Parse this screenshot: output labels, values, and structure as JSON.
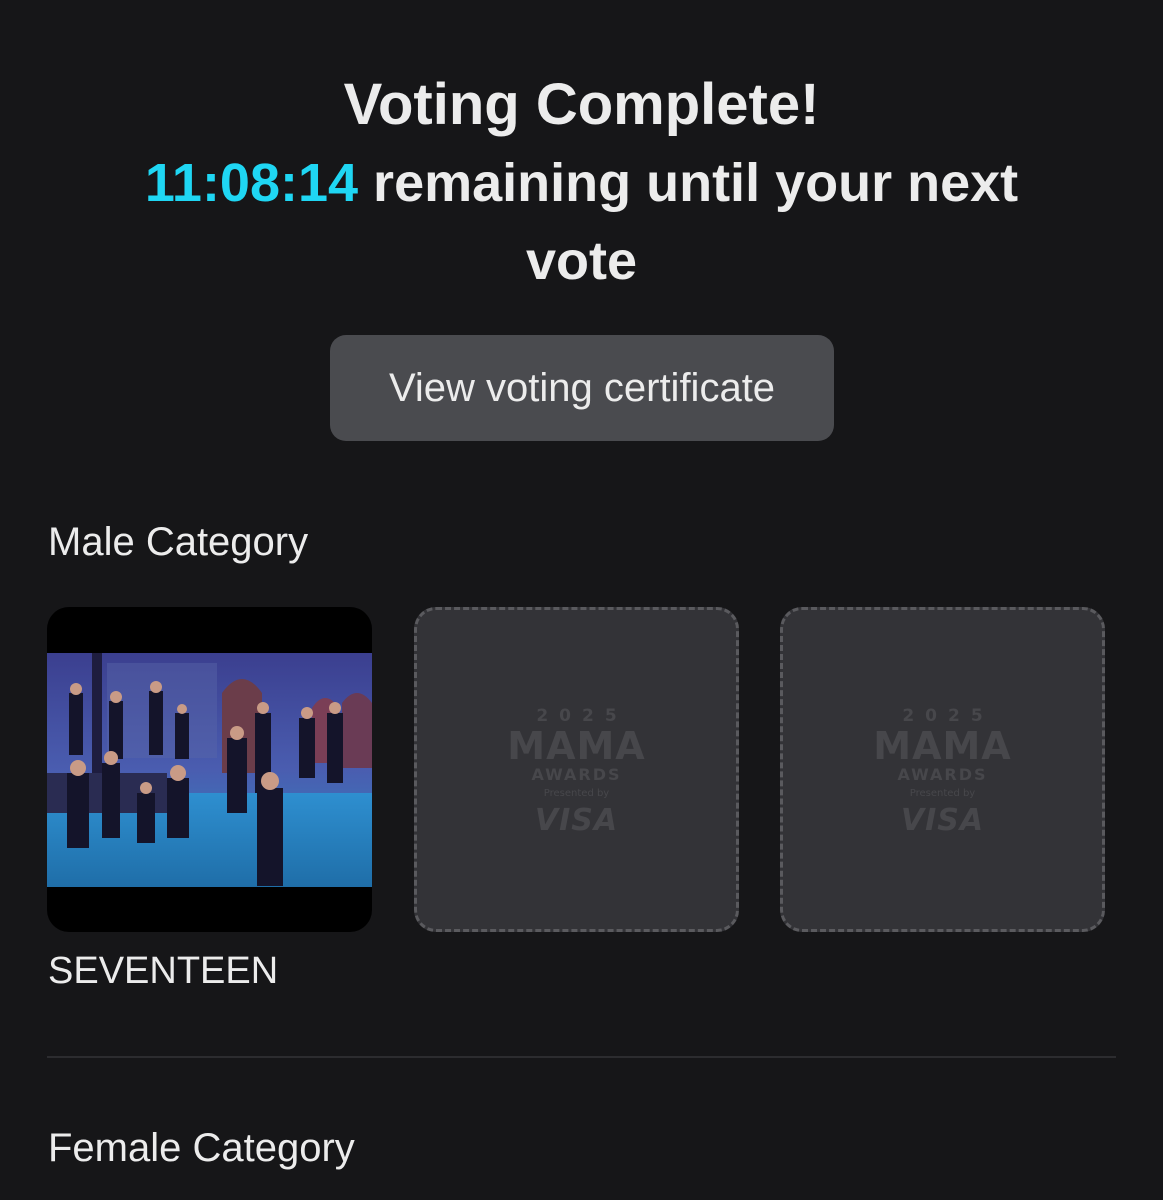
{
  "header": {
    "title": "Voting Complete!",
    "timer": "11:08:14",
    "countdown_text": " remaining until your next vote"
  },
  "certificate_button": {
    "label": "View voting certificate"
  },
  "male_category": {
    "title": "Male Category",
    "slots": [
      {
        "state": "voted",
        "artist": "SEVENTEEN",
        "image": "group-photo"
      },
      {
        "state": "empty",
        "placeholder_logo": {
          "year": "2025",
          "name": "MAMA",
          "subtitle": "AWARDS",
          "presented": "Presented by",
          "sponsor": "VISA"
        }
      },
      {
        "state": "empty",
        "placeholder_logo": {
          "year": "2025",
          "name": "MAMA",
          "subtitle": "AWARDS",
          "presented": "Presented by",
          "sponsor": "VISA"
        }
      }
    ]
  },
  "female_category": {
    "title": "Female Category"
  },
  "colors": {
    "background": "#161618",
    "accent_timer": "#1fd6f3",
    "button_bg": "#4a4b4f",
    "empty_card_bg": "#333337"
  }
}
